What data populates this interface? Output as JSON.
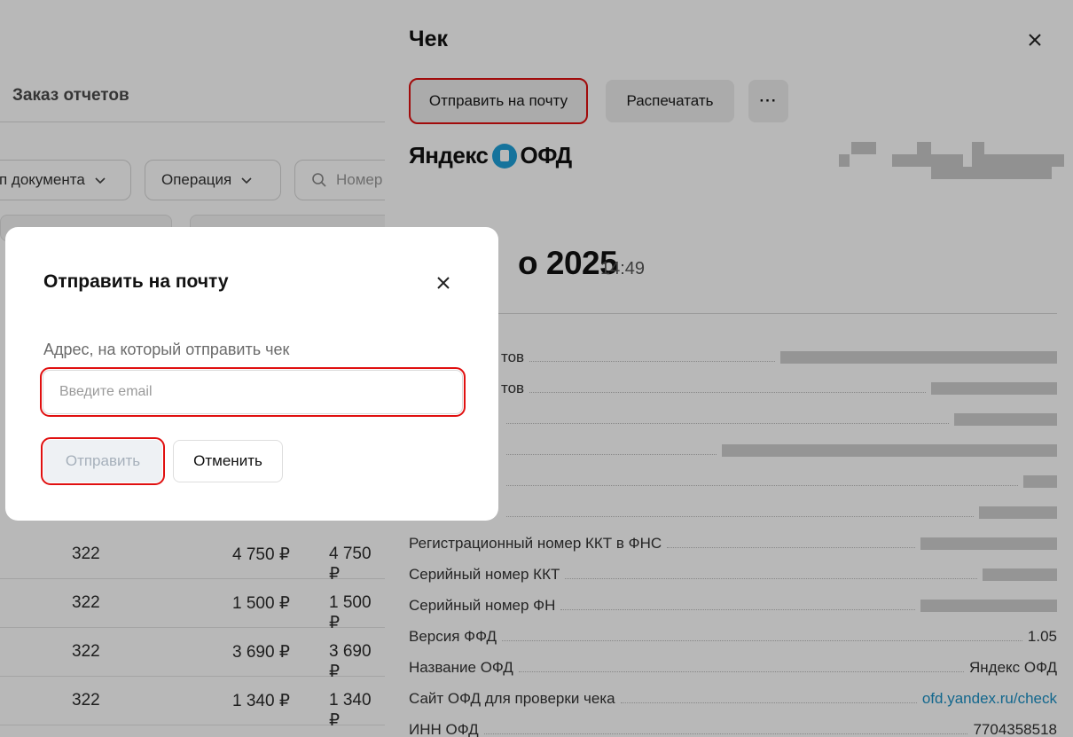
{
  "background": {
    "tab_label": "Заказ отчетов",
    "filters": {
      "doc_type": "п документа",
      "operation": "Операция",
      "search_placeholder": "Номер"
    },
    "rows": [
      {
        "col1": "322",
        "col2": "4 750 ₽",
        "col3": "4 750 ₽"
      },
      {
        "col1": "322",
        "col2": "1 500 ₽",
        "col3": "1 500 ₽"
      },
      {
        "col1": "322",
        "col2": "3 690 ₽",
        "col3": "3 690 ₽"
      },
      {
        "col1": "322",
        "col2": "1 340 ₽",
        "col3": "1 340 ₽"
      }
    ]
  },
  "drawer": {
    "title": "Чек",
    "buttons": {
      "send_email": "Отправить на почту",
      "print": "Распечатать",
      "more": "···"
    },
    "logo": {
      "left": "Яндекс",
      "right": "ОФД"
    },
    "date": {
      "big": "о 2025",
      "time": "14:49"
    },
    "fields": [
      {
        "key": "тов",
        "value": ""
      },
      {
        "key": "тов",
        "value": ""
      },
      {
        "key": "Регистрационный номер ККТ в ФНС",
        "value": ""
      },
      {
        "key": "Серийный номер ККТ",
        "value": ""
      },
      {
        "key": "Серийный номер ФН",
        "value": ""
      },
      {
        "key": "Версия ФФД",
        "value": "1.05"
      },
      {
        "key": "Название ОФД",
        "value": "Яндекс ОФД"
      },
      {
        "key": "Сайт ОФД для проверки чека",
        "value": "ofd.yandex.ru/check"
      },
      {
        "key": "ИНН ОФД",
        "value": "7704358518"
      }
    ]
  },
  "modal": {
    "title": "Отправить на почту",
    "label": "Адрес, на который отправить чек",
    "email_placeholder": "Введите email",
    "email_value": "",
    "send_label": "Отправить",
    "cancel_label": "Отменить"
  },
  "colors": {
    "highlight": "#e01010",
    "link": "#1a8fc4",
    "logo_badge": "#1ea0d8"
  }
}
